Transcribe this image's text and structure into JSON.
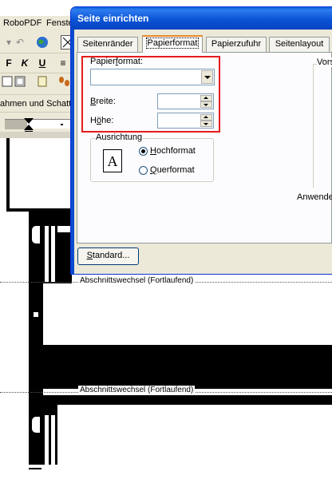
{
  "app": {
    "menu": {
      "item1": "RoboPDF",
      "item2": "Fenste"
    },
    "toolbar": {
      "back_arrow": "↶",
      "bold": "F",
      "italic": "K",
      "underline": "U",
      "align": "≡",
      "frames_label": "ahmen und Schatti"
    }
  },
  "document": {
    "section_break_1": "Abschnittswechsel (Fortlaufend)",
    "section_break_2": "Abschnittswechsel (Fortlaufend)"
  },
  "dialog": {
    "title": "Seite einrichten",
    "tabs": [
      {
        "label": "Seitenränder",
        "active": false
      },
      {
        "label": "Papierformat",
        "active": true
      },
      {
        "label": "Papierzufuhr",
        "active": false
      },
      {
        "label": "Seitenlayout",
        "active": false
      }
    ],
    "paper_format": {
      "label_prefix": "Papier",
      "label_underlined": "f",
      "label_suffix": "ormat:",
      "value": ""
    },
    "width": {
      "label_underlined": "B",
      "label_suffix": "reite:",
      "value": ""
    },
    "height": {
      "label_prefix": "H",
      "label_underlined": "ö",
      "label_suffix": "he:",
      "value": ""
    },
    "orientation": {
      "legend": "Ausrichtung",
      "icon_letter": "A",
      "portrait": {
        "label_underlined": "H",
        "label_suffix": "ochformat",
        "selected": true
      },
      "landscape": {
        "label_underlined": "Q",
        "label_suffix": "uerformat",
        "selected": false
      }
    },
    "preview_label": "Vors",
    "apply_label": "Anwende",
    "default_button": {
      "label_underlined": "S",
      "label_suffix": "tandard..."
    }
  },
  "colors": {
    "title_bar": "#0a54d6",
    "dialog_bg": "#ece9d8",
    "highlight_box": "#e51b1b",
    "active_tab_accent": "#e68b2c"
  }
}
